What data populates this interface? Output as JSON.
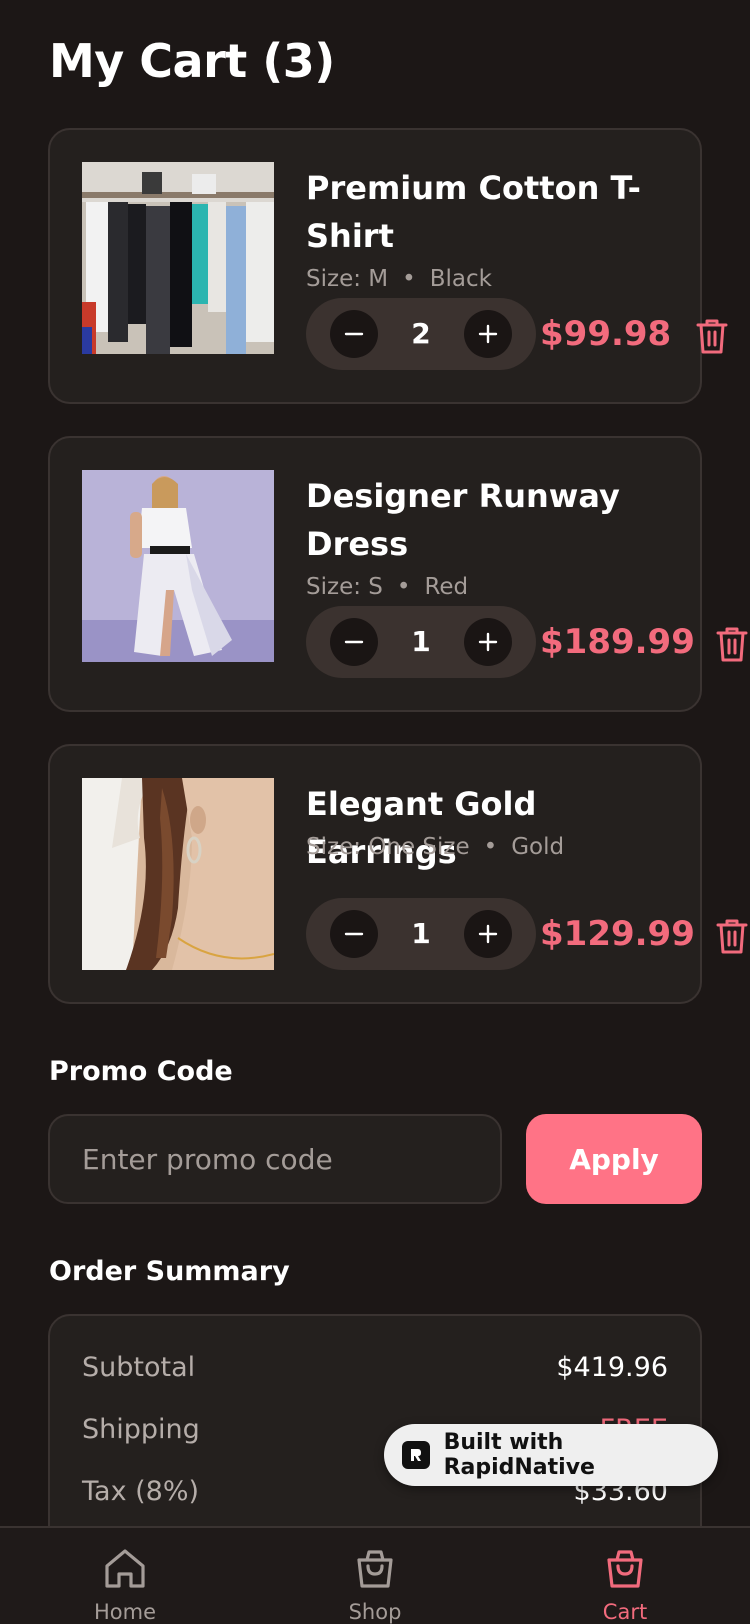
{
  "header": {
    "title": "My Cart (3)"
  },
  "cart_items": [
    {
      "name": "Premium Cotton T-Shirt",
      "size": "Size: M",
      "color": "Black",
      "quantity": "2",
      "price": "$99.98",
      "image": "clothing-rack-photo"
    },
    {
      "name": "Designer Runway Dress",
      "size": "Size: S",
      "color": "Red",
      "quantity": "1",
      "price": "$189.99",
      "image": "runway-dress-photo"
    },
    {
      "name": "Elegant Gold Earrings",
      "size": "Size: One Size",
      "color": "Gold",
      "quantity": "1",
      "price": "$129.99",
      "image": "gold-earrings-photo"
    }
  ],
  "promo": {
    "title": "Promo Code",
    "placeholder": "Enter promo code",
    "value": "",
    "apply_label": "Apply"
  },
  "summary": {
    "title": "Order Summary",
    "rows": [
      {
        "label": "Subtotal",
        "value": "$419.96"
      },
      {
        "label": "Shipping",
        "value": "FREE"
      },
      {
        "label": "Tax (8%)",
        "value": "$33.60"
      }
    ]
  },
  "badge": {
    "text": "Built with RapidNative"
  },
  "tabs": [
    {
      "label": "Home",
      "icon": "home-icon",
      "active": false
    },
    {
      "label": "Shop",
      "icon": "shopping-bag-icon",
      "active": false
    },
    {
      "label": "Cart",
      "icon": "cart-bag-icon",
      "active": true
    }
  ],
  "colors": {
    "background": "#1c1716",
    "card": "#24201e",
    "accent": "#ff7386",
    "price": "#f26b7d",
    "muted": "#a49c98"
  }
}
